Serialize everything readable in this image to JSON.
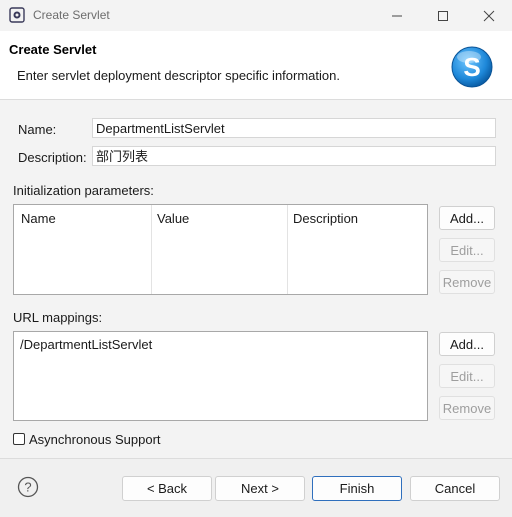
{
  "window": {
    "title": "Create Servlet",
    "minimize_icon": "minimize-icon",
    "maximize_icon": "maximize-icon",
    "close_icon": "close-icon"
  },
  "header": {
    "title": "Create Servlet",
    "description": "Enter servlet deployment descriptor specific information.",
    "logo_icon": "servlet-wizard-logo-icon",
    "logo_letter": "S"
  },
  "form": {
    "name_label": "Name:",
    "name_value": "DepartmentListServlet",
    "description_label": "Description:",
    "description_value": "部门列表"
  },
  "init_params": {
    "label": "Initialization parameters:",
    "columns": [
      "Name",
      "Value",
      "Description"
    ],
    "rows": [],
    "add_label": "Add...",
    "edit_label": "Edit...",
    "remove_label": "Remove"
  },
  "url_mappings": {
    "label": "URL mappings:",
    "items": [
      "/DepartmentListServlet"
    ],
    "add_label": "Add...",
    "edit_label": "Edit...",
    "remove_label": "Remove"
  },
  "async": {
    "label": "Asynchronous Support",
    "checked": false
  },
  "footer": {
    "help_icon": "help-icon",
    "back_label": "< Back",
    "next_label": "Next >",
    "finish_label": "Finish",
    "cancel_label": "Cancel"
  },
  "colors": {
    "accent": "#2f6fbd",
    "logo_blue": "#1e88d9"
  }
}
